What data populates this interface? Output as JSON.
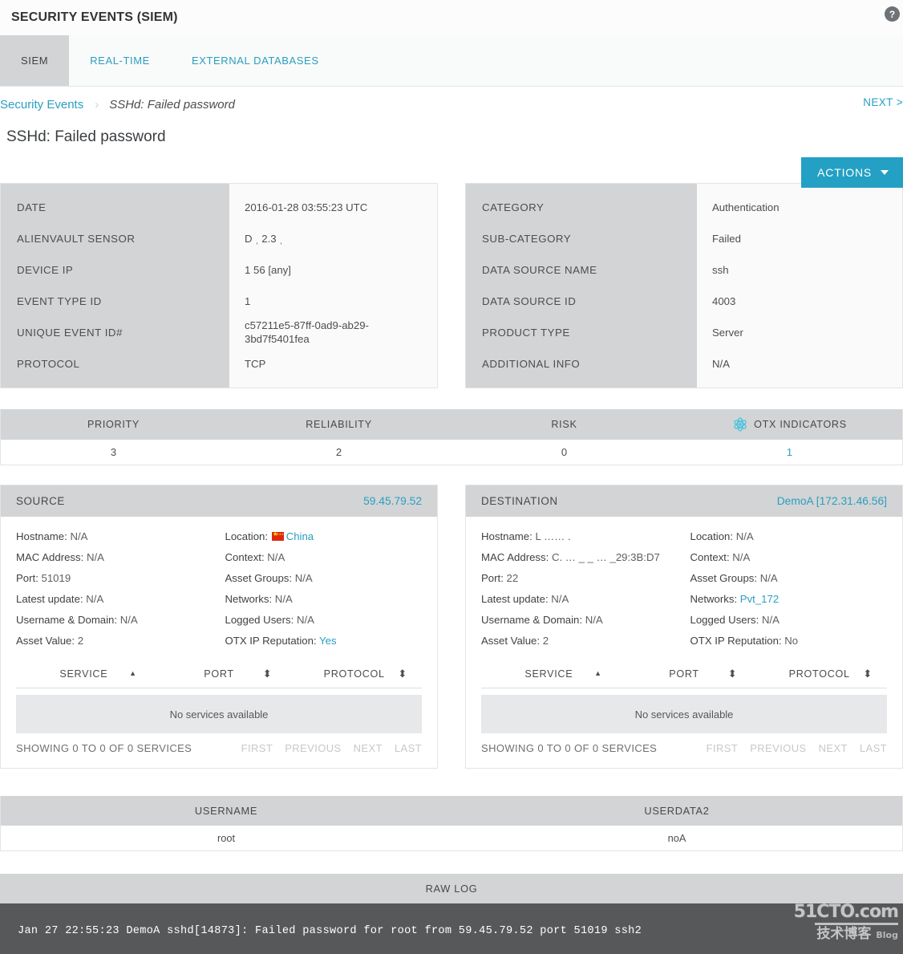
{
  "header": {
    "app_title": "SECURITY EVENTS (SIEM)",
    "help_icon_label": "?"
  },
  "tabs": [
    {
      "label": "SIEM",
      "active": true
    },
    {
      "label": "REAL-TIME",
      "active": false
    },
    {
      "label": "EXTERNAL DATABASES",
      "active": false
    }
  ],
  "breadcrumb": {
    "root": "Security Events",
    "separator": "›",
    "current": "SSHd: Failed password",
    "next_link": "NEXT >"
  },
  "page": {
    "title": "SSHd: Failed password",
    "actions_label": "ACTIONS"
  },
  "event_info_left": [
    {
      "label": "DATE",
      "value": "2016-01-28 03:55:23 UTC"
    },
    {
      "label": "ALIENVAULT SENSOR",
      "value": "D        ˌ  2.3         ˌ"
    },
    {
      "label": "DEVICE IP",
      "value": "1              56 [any]"
    },
    {
      "label": "EVENT TYPE ID",
      "value": "1"
    },
    {
      "label": "UNIQUE EVENT ID#",
      "value": "c57211e5-87ff-0ad9-ab29-\n3bd7f5401fea"
    },
    {
      "label": "PROTOCOL",
      "value": "TCP"
    }
  ],
  "event_info_right": [
    {
      "label": "CATEGORY",
      "value": "Authentication"
    },
    {
      "label": "SUB-CATEGORY",
      "value": "Failed"
    },
    {
      "label": "DATA SOURCE NAME",
      "value": "ssh"
    },
    {
      "label": "DATA SOURCE ID",
      "value": "4003"
    },
    {
      "label": "PRODUCT TYPE",
      "value": "Server"
    },
    {
      "label": "ADDITIONAL INFO",
      "value": "N/A",
      "muted": true
    }
  ],
  "metrics": {
    "headers": [
      "PRIORITY",
      "RELIABILITY",
      "RISK",
      "OTX INDICATORS"
    ],
    "otx_icon": "atom-icon",
    "values": [
      "3",
      "2",
      "0",
      "1"
    ],
    "otx_value_is_link": true
  },
  "source": {
    "title": "SOURCE",
    "ip": "59.45.79.52",
    "left_fields": [
      {
        "key": "Hostname",
        "value": "N/A"
      },
      {
        "key": "MAC Address",
        "value": "N/A"
      },
      {
        "key": "Port",
        "value": "51019"
      },
      {
        "key": "Latest update",
        "value": "N/A"
      },
      {
        "key": "Username & Domain",
        "value": "N/A"
      },
      {
        "key": "Asset Value",
        "value": "2"
      }
    ],
    "right_fields": [
      {
        "key": "Location",
        "value": "China",
        "link": true,
        "flag": "cn-flag-icon"
      },
      {
        "key": "Context",
        "value": "N/A"
      },
      {
        "key": "Asset Groups",
        "value": "N/A"
      },
      {
        "key": "Networks",
        "value": "N/A"
      },
      {
        "key": "Logged Users",
        "value": "N/A"
      },
      {
        "key": "OTX IP Reputation",
        "value": "Yes",
        "link": true
      }
    ],
    "services": {
      "headers": [
        "SERVICE",
        "PORT",
        "PROTOCOL"
      ],
      "sort_icons": [
        "sort-asc-icon",
        "sort-both-icon",
        "sort-both-icon"
      ],
      "empty_text": "No services available",
      "showing": "SHOWING 0 TO 0 OF 0 SERVICES",
      "pager": [
        "FIRST",
        "PREVIOUS",
        "NEXT",
        "LAST"
      ]
    }
  },
  "destination": {
    "title": "DESTINATION",
    "ip": "DemoA [172.31.46.56]",
    "left_fields": [
      {
        "key": "Hostname",
        "value": "L …… ."
      },
      {
        "key": "MAC Address",
        "value": "C. … _ _ … _29:3B:D7"
      },
      {
        "key": "Port",
        "value": "22"
      },
      {
        "key": "Latest update",
        "value": "N/A"
      },
      {
        "key": "Username & Domain",
        "value": "N/A"
      },
      {
        "key": "Asset Value",
        "value": "2"
      }
    ],
    "right_fields": [
      {
        "key": "Location",
        "value": "N/A"
      },
      {
        "key": "Context",
        "value": "N/A"
      },
      {
        "key": "Asset Groups",
        "value": "N/A"
      },
      {
        "key": "Networks",
        "value": "Pvt_172",
        "link": true
      },
      {
        "key": "Logged Users",
        "value": "N/A"
      },
      {
        "key": "OTX IP Reputation",
        "value": "No"
      }
    ],
    "services": {
      "headers": [
        "SERVICE",
        "PORT",
        "PROTOCOL"
      ],
      "sort_icons": [
        "sort-asc-icon",
        "sort-both-icon",
        "sort-both-icon"
      ],
      "empty_text": "No services available",
      "showing": "SHOWING 0 TO 0 OF 0 SERVICES",
      "pager": [
        "FIRST",
        "PREVIOUS",
        "NEXT",
        "LAST"
      ]
    }
  },
  "user_table": {
    "headers": [
      "USERNAME",
      "USERDATA2"
    ],
    "rows": [
      [
        "root",
        "noA"
      ]
    ]
  },
  "raw_log": {
    "title": "RAW LOG",
    "line": "Jan 27 22:55:23 DemoA sshd[14873]: Failed password for root from 59.45.79.52 port 51019 ssh2"
  },
  "watermark": {
    "top": "51CTO.com",
    "cn": "技术博客",
    "blog": "Blog"
  },
  "colors": {
    "accent": "#23a0c4",
    "link": "#2a9fc0",
    "header_gray": "#d3d4d5",
    "raw_log_bg": "#57585a",
    "flag_red": "#de2910"
  }
}
